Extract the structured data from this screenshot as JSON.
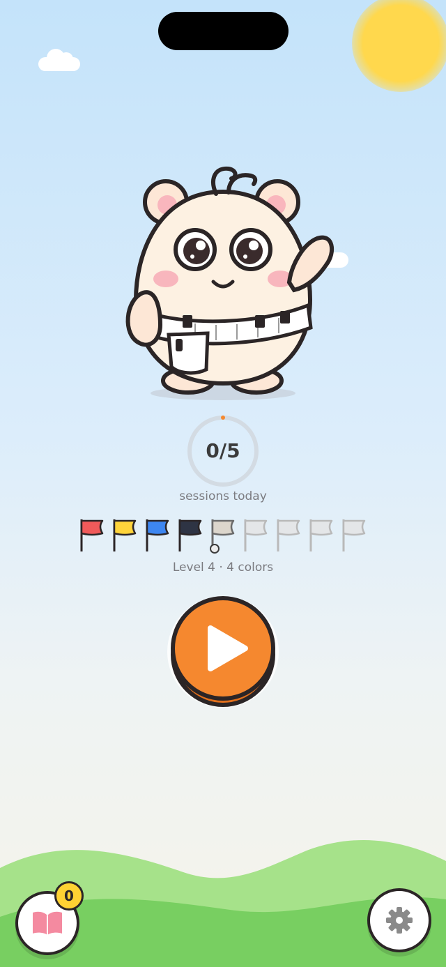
{
  "session": {
    "count": "0/5",
    "label": "sessions today",
    "progress": 0
  },
  "level": {
    "label": "Level 4 · 4 colors",
    "unlocked_colors": [
      "#f05a5a",
      "#ffd43b",
      "#3d86f0",
      "#2e3444"
    ],
    "total_flags": 9,
    "current_index": 4
  },
  "library": {
    "badge": "0"
  },
  "colors": {
    "accent": "#f5882f",
    "outline": "#2b2526",
    "hill_back": "#a6e28a",
    "hill_front": "#78cf61"
  },
  "icons": {
    "play": "play-icon",
    "book": "book-icon",
    "settings": "gear-icon"
  }
}
